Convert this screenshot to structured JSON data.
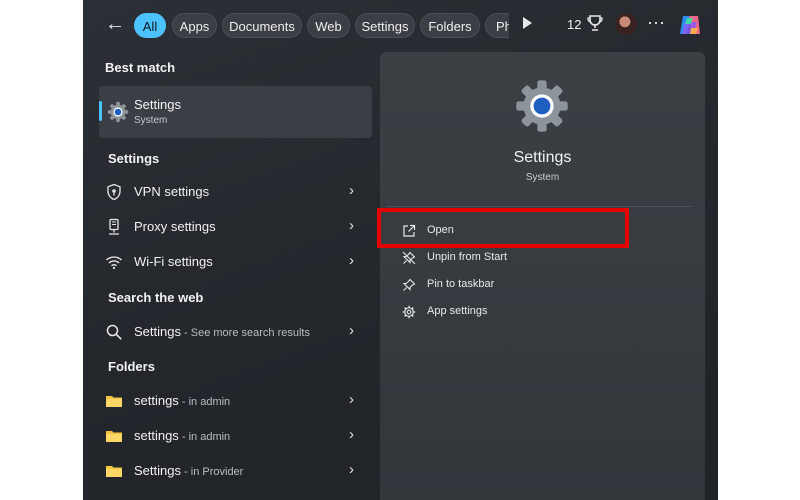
{
  "filters": [
    "All",
    "Apps",
    "Documents",
    "Web",
    "Settings",
    "Folders",
    "Pho"
  ],
  "topbar": {
    "points": "12"
  },
  "best_match": {
    "heading": "Best match",
    "title": "Settings",
    "subtitle": "System"
  },
  "settings_section": {
    "heading": "Settings",
    "items": [
      {
        "label": "VPN settings",
        "icon": "shield-icon"
      },
      {
        "label": "Proxy settings",
        "icon": "proxy-icon"
      },
      {
        "label": "Wi-Fi settings",
        "icon": "wifi-icon"
      }
    ]
  },
  "web_section": {
    "heading": "Search the web",
    "query": "Settings",
    "hint": " - See more search results"
  },
  "folders_section": {
    "heading": "Folders",
    "items": [
      {
        "name": "settings",
        "location": " - in admin"
      },
      {
        "name": "settings",
        "location": " - in admin"
      },
      {
        "name": "Settings",
        "location": " - in Provider"
      }
    ]
  },
  "preview": {
    "title": "Settings",
    "subtitle": "System",
    "actions": [
      "Open",
      "Unpin from Start",
      "Pin to taskbar",
      "App settings"
    ]
  },
  "colors": {
    "accent": "#4cc2ff",
    "highlight": "#e60000",
    "folder": "#f5c542"
  }
}
